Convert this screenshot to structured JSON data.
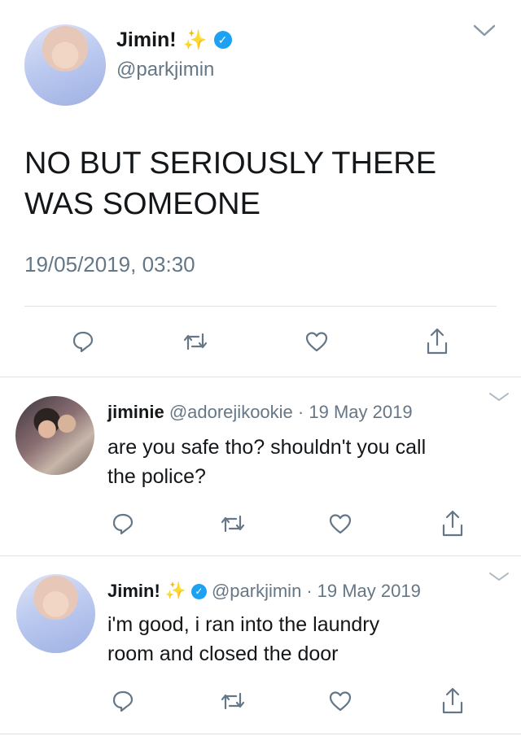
{
  "main_tweet": {
    "display_name": "Jimin!",
    "emoji": "✨",
    "handle": "@parkjimin",
    "text_line1": "NO BUT SERIOUSLY THERE",
    "text_line2": "WAS SOMEONE",
    "timestamp": "19/05/2019, 03:30"
  },
  "reply1": {
    "display_name": "jiminie",
    "handle": "@adorejikookie",
    "separator": "·",
    "date": "19 May 2019",
    "text_line1": "are you safe tho? shouldn't you call",
    "text_line2": "the police?"
  },
  "reply2": {
    "display_name": "Jimin!",
    "emoji": "✨",
    "handle": "@parkjimin",
    "separator": "·",
    "date": "19 May 2019",
    "text_line1": "i'm good, i ran into the laundry",
    "text_line2": "room and closed the door"
  },
  "icons": {
    "verified": "✓",
    "reply": "reply-icon",
    "retweet": "retweet-icon",
    "like": "heart-icon",
    "share": "share-icon",
    "menu": "chevron-down-icon"
  },
  "colors": {
    "verified_blue": "#1da1f2",
    "muted_gray": "#657786",
    "icon_gray": "#657786",
    "divider": "#dfe3e6"
  }
}
